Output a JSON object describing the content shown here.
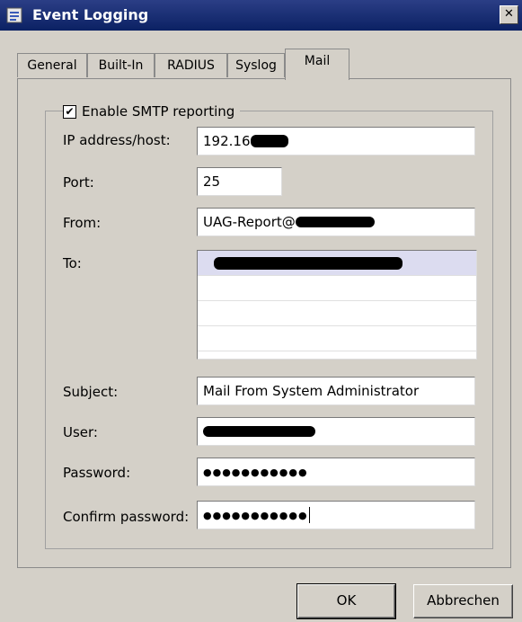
{
  "window": {
    "title": "Event Logging",
    "close_glyph": "✕"
  },
  "tabs": [
    {
      "label": "General",
      "active": false
    },
    {
      "label": "Built-In",
      "active": false
    },
    {
      "label": "RADIUS",
      "active": false
    },
    {
      "label": "Syslog",
      "active": false
    },
    {
      "label": "Mail",
      "active": true
    }
  ],
  "group": {
    "enable_label": "Enable SMTP reporting",
    "enabled": true,
    "check_glyph": "✔"
  },
  "fields": {
    "ip": {
      "label": "IP address/host:",
      "value": "192.16"
    },
    "port": {
      "label": "Port:",
      "value": "25"
    },
    "from": {
      "label": "From:",
      "value": "UAG-Report@"
    },
    "to": {
      "label": "To:"
    },
    "subject": {
      "label": "Subject:",
      "value": "Mail From System Administrator"
    },
    "user": {
      "label": "User:"
    },
    "password": {
      "label": "Password:",
      "value": "●●●●●●●●●●●"
    },
    "confirm": {
      "label": "Confirm password:",
      "value": "●●●●●●●●●●●"
    }
  },
  "buttons": {
    "ok": "OK",
    "cancel": "Abbrechen"
  }
}
